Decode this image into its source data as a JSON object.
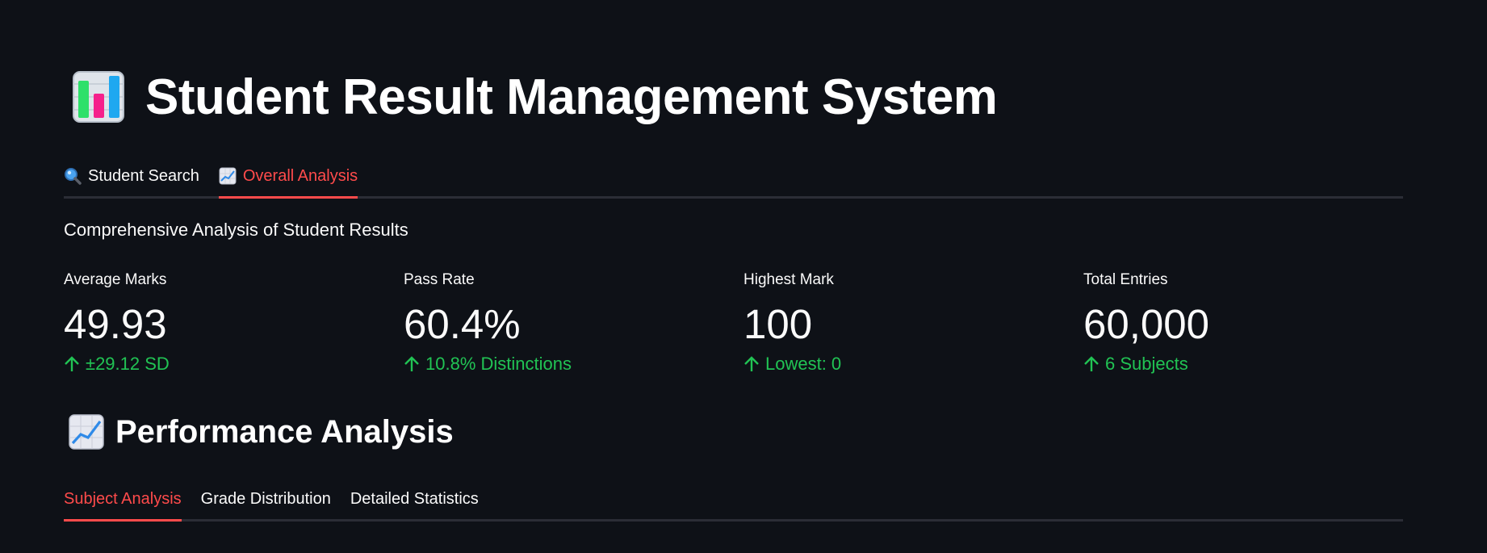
{
  "app": {
    "title": "Student Result Management System",
    "title_icon": "bar-chart-emoji"
  },
  "main_tabs": [
    {
      "label": "Student Search",
      "icon": "magnifying-glass-icon",
      "active": false
    },
    {
      "label": "Overall Analysis",
      "icon": "chart-increasing-icon",
      "active": true
    }
  ],
  "subtitle": "Comprehensive Analysis of Student Results",
  "metrics": [
    {
      "label": "Average Marks",
      "value": "49.93",
      "delta": "±29.12 SD"
    },
    {
      "label": "Pass Rate",
      "value": "60.4%",
      "delta": "10.8% Distinctions"
    },
    {
      "label": "Highest Mark",
      "value": "100",
      "delta": "Lowest: 0"
    },
    {
      "label": "Total Entries",
      "value": "60,000",
      "delta": "6 Subjects"
    }
  ],
  "section": {
    "title": "Performance Analysis",
    "icon": "chart-increasing-emoji"
  },
  "sub_tabs": [
    {
      "label": "Subject Analysis",
      "active": true
    },
    {
      "label": "Grade Distribution",
      "active": false
    },
    {
      "label": "Detailed Statistics",
      "active": false
    }
  ],
  "colors": {
    "background": "#0e1117",
    "accent": "#ff4b4b",
    "delta_positive": "#21c354",
    "divider": "#2b2d36"
  }
}
